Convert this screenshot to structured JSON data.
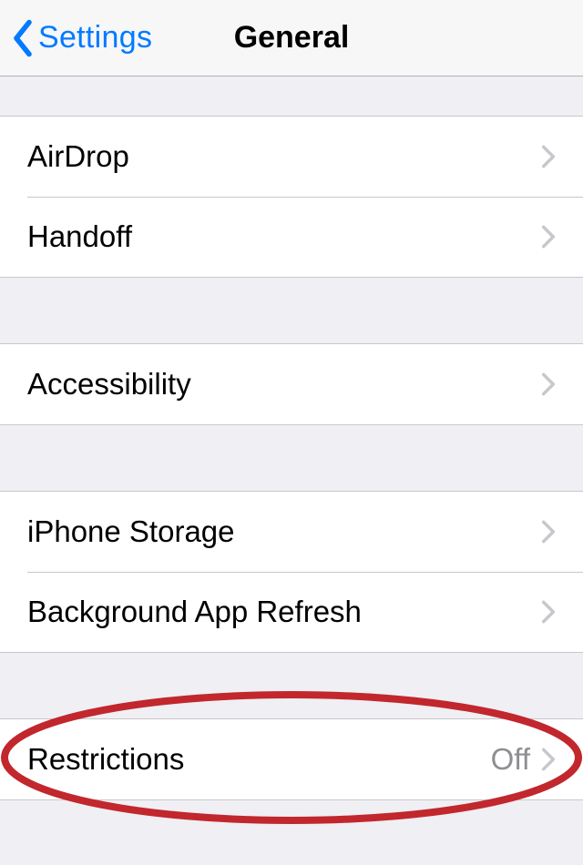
{
  "nav": {
    "back_label": "Settings",
    "title": "General"
  },
  "groups": [
    {
      "rows": [
        {
          "id": "airdrop",
          "label": "AirDrop",
          "detail": null
        },
        {
          "id": "handoff",
          "label": "Handoff",
          "detail": null
        }
      ]
    },
    {
      "rows": [
        {
          "id": "accessibility",
          "label": "Accessibility",
          "detail": null
        }
      ]
    },
    {
      "rows": [
        {
          "id": "iphone-storage",
          "label": "iPhone Storage",
          "detail": null
        },
        {
          "id": "background-refresh",
          "label": "Background App Refresh",
          "detail": null
        }
      ]
    },
    {
      "rows": [
        {
          "id": "restrictions",
          "label": "Restrictions",
          "detail": "Off"
        }
      ]
    }
  ],
  "annotation": {
    "type": "ellipse",
    "target": "restrictions",
    "color": "#c1272d"
  }
}
